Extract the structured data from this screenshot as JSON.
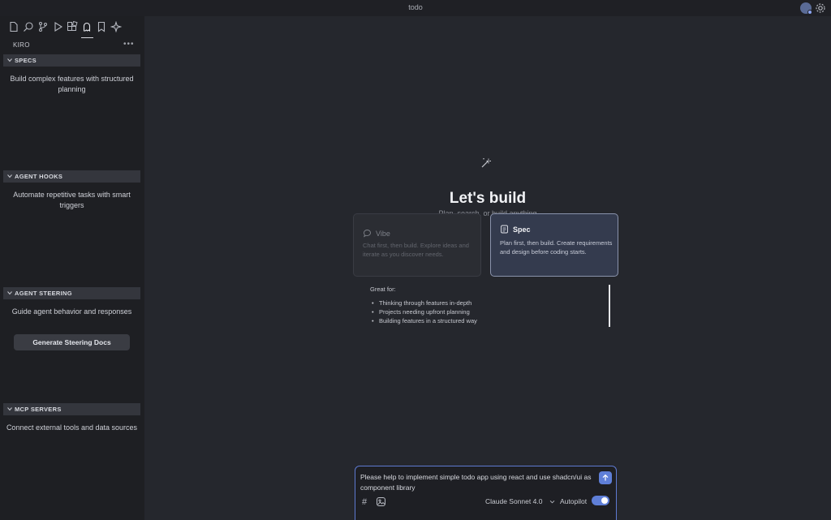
{
  "window": {
    "title": "todo"
  },
  "sidebar": {
    "title": "KIRO",
    "more": "•••",
    "activity_icons": [
      "explorer-icon",
      "search-icon",
      "source-control-icon",
      "run-debug-icon",
      "extensions-icon",
      "kiro-ghost-icon",
      "bookmark-icon",
      "sparkle-icon"
    ],
    "sections": [
      {
        "header": "SPECS",
        "description": "Build complex features with structured planning"
      },
      {
        "header": "AGENT HOOKS",
        "description": "Automate repetitive tasks with smart triggers"
      },
      {
        "header": "AGENT STEERING",
        "description": "Guide agent behavior and responses",
        "button": "Generate Steering Docs"
      },
      {
        "header": "MCP SERVERS",
        "description": "Connect external tools and data sources"
      }
    ]
  },
  "main": {
    "title": "Let's build",
    "subtitle": "Plan, search, or build anything",
    "modes": [
      {
        "title": "Vibe",
        "description": "Chat first, then build. Explore ideas and iterate as you discover needs.",
        "selected": false
      },
      {
        "title": "Spec",
        "description": "Plan first, then build. Create requirements and design before coding starts.",
        "selected": true
      }
    ],
    "great_for": {
      "heading": "Great for:",
      "items": [
        "Thinking through features in-depth",
        "Projects needing upfront planning",
        "Building features in a structured way"
      ]
    }
  },
  "chat": {
    "input_value": "Please help to implement simple todo app using react and use shadcn/ui as component library",
    "hash": "#",
    "model": "Claude Sonnet 4.0",
    "autopilot_label": "Autopilot",
    "autopilot_on": true
  },
  "colors": {
    "accent": "#5f7fd8",
    "sidebar_bg": "#1e1f23",
    "main_bg": "#25272d"
  }
}
